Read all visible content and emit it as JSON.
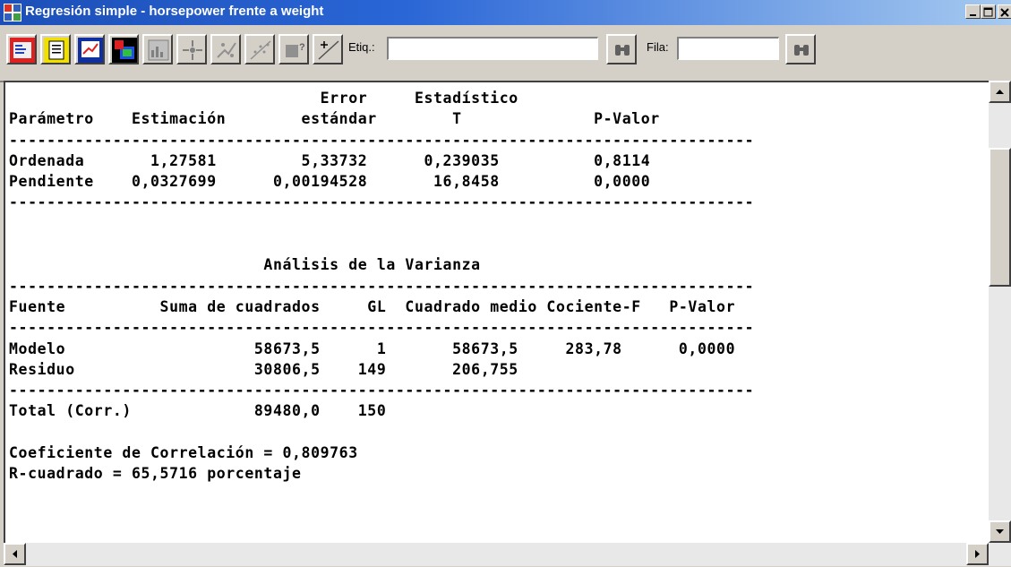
{
  "window": {
    "title": "Regresión simple - horsepower frente a weight"
  },
  "toolbar": {
    "etiq_label": "Etiq.:",
    "etiq_value": "",
    "fila_label": "Fila:",
    "fila_value": "",
    "icons": [
      "input-dialog-icon",
      "analysis-options-icon",
      "tables-icon",
      "graphs-icon",
      "save-results-icon",
      "exclude-points-icon",
      "locate-icon",
      "smooth-icon",
      "identify-icon",
      "help-tooltip-icon",
      "add-line-icon",
      "search-icon"
    ]
  },
  "report": {
    "text": "                                 Error     Estadístico\nParámetro    Estimación        estándar        T              P-Valor\n-------------------------------------------------------------------------------\nOrdenada       1,27581         5,33732      0,239035          0,8114\nPendiente    0,0327699      0,00194528       16,8458          0,0000\n-------------------------------------------------------------------------------\n\n\n                           Análisis de la Varianza\n-------------------------------------------------------------------------------\nFuente          Suma de cuadrados     GL  Cuadrado medio Cociente-F   P-Valor\n-------------------------------------------------------------------------------\nModelo                    58673,5      1       58673,5     283,78      0,0000\nResiduo                   30806,5    149       206,755\n-------------------------------------------------------------------------------\nTotal (Corr.)             89480,0    150\n\nCoeficiente de Correlación = 0,809763\nR-cuadrado = 65,5716 porcentaje"
  },
  "colors": {
    "titlebar_start": "#1c4fb8",
    "titlebar_end": "#a6caf0",
    "chrome": "#d4d0c8",
    "content_bg": "#ffffff"
  }
}
